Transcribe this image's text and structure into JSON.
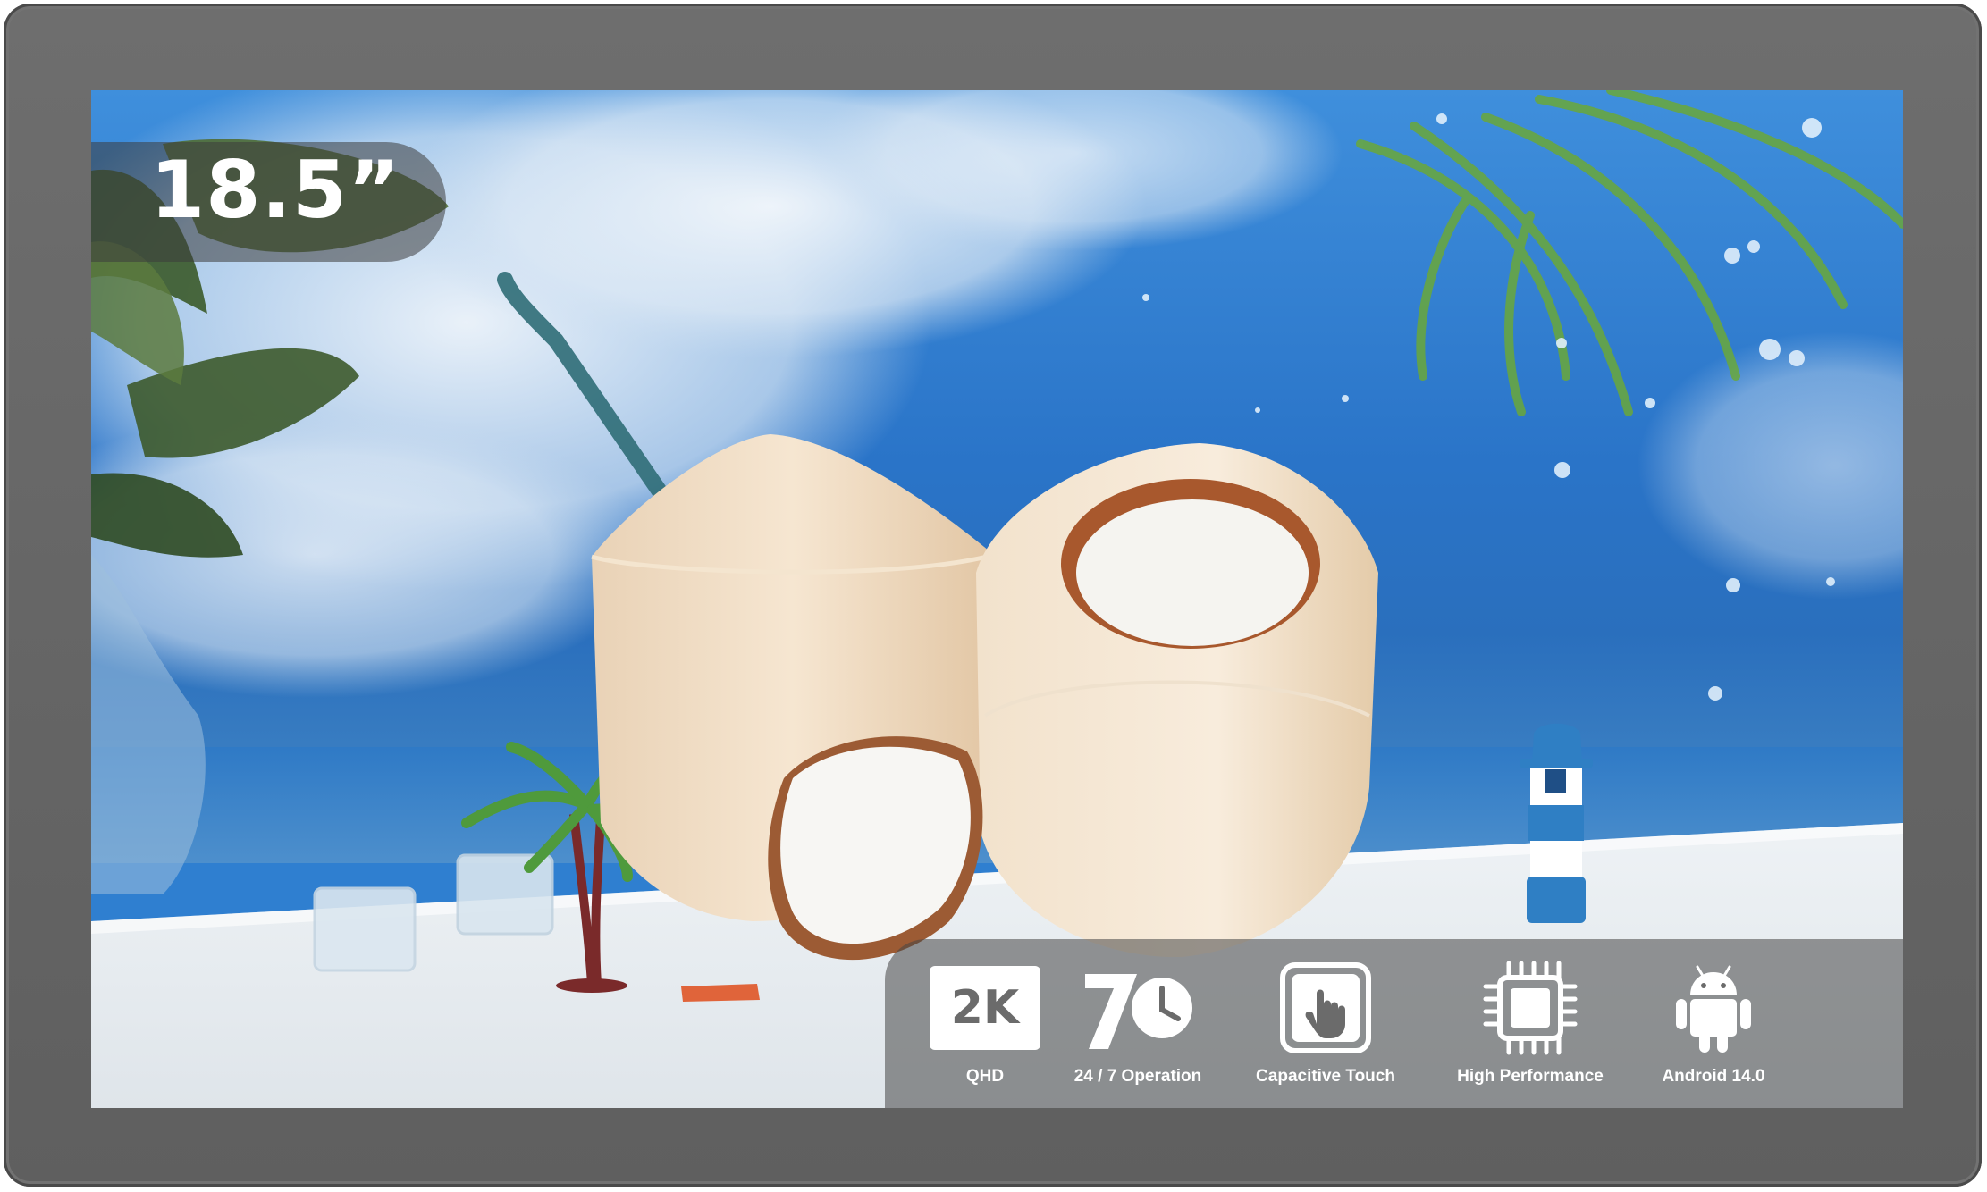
{
  "screen_size_label": "18.5”",
  "features": [
    {
      "label": "QHD",
      "icon": "2k-icon",
      "icon_text": "2K"
    },
    {
      "label": "24 / 7 Operation",
      "icon": "24-7-clock-icon"
    },
    {
      "label": "Capacitive Touch",
      "icon": "touch-hand-icon"
    },
    {
      "label": "High Performance",
      "icon": "cpu-chip-icon"
    },
    {
      "label": "Android 14.0",
      "icon": "android-icon"
    }
  ],
  "colors": {
    "bezel": "#666666",
    "sky": "#2f7fd0",
    "overlay": "rgba(70,70,70,0.55)",
    "text": "#ffffff"
  }
}
